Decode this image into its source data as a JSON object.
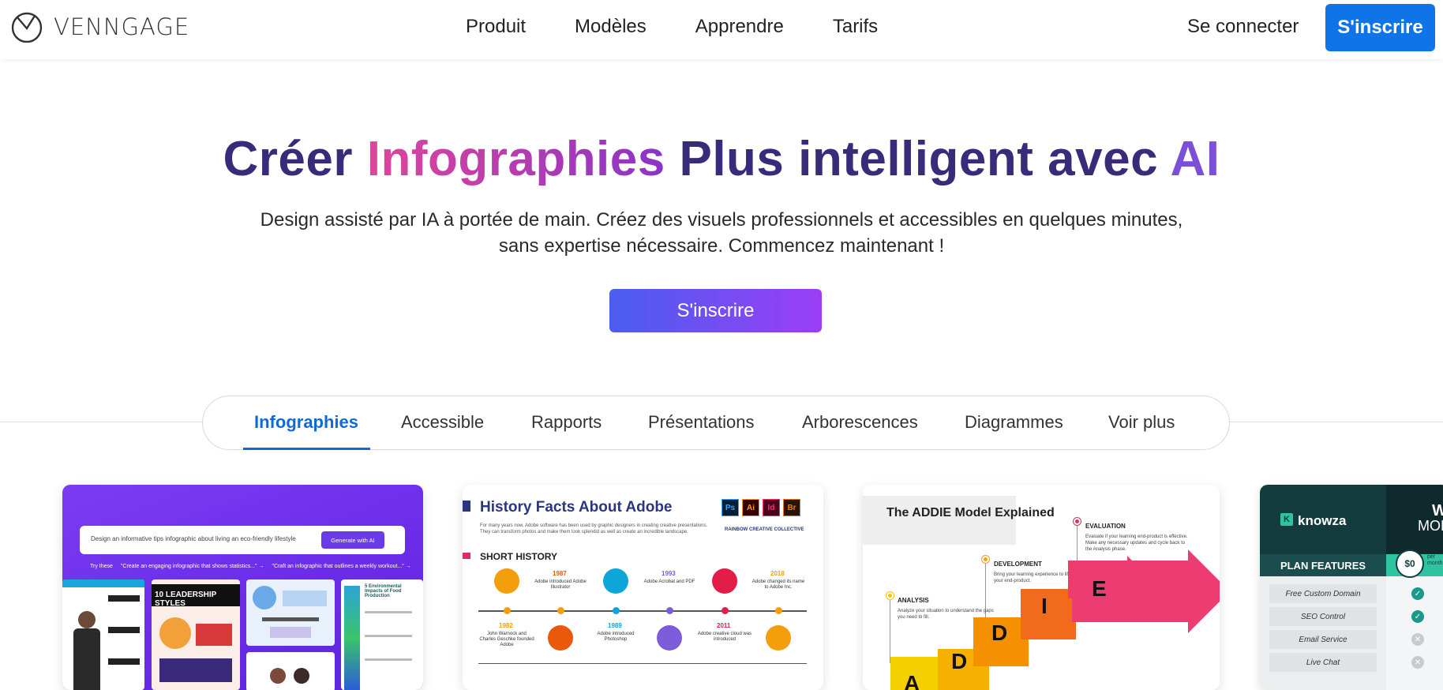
{
  "brand": {
    "name": "VENNGAGE"
  },
  "nav": {
    "links": [
      "Produit",
      "Modèles",
      "Apprendre",
      "Tarifs"
    ],
    "signin": "Se connecter",
    "signup": "S'inscrire"
  },
  "hero": {
    "title_part1": "Créer ",
    "title_part2": "Infographies",
    "title_part3": " Plus intelligent avec ",
    "title_part4": "AI",
    "subtitle": "Design assisté par IA à portée de main. Créez des visuels professionnels et accessibles en quelques minutes, sans expertise nécessaire. Commencez maintenant !",
    "cta": "S'inscrire"
  },
  "tabs": [
    "Infographies",
    "Accessible",
    "Rapports",
    "Présentations",
    "Arborescences",
    "Diagrammes",
    "Voir plus"
  ],
  "active_tab": "Infographies",
  "colors": {
    "accent": "#0f74e8",
    "title": "#3a2a7a",
    "gradient_start": "#4a5ef0",
    "gradient_end": "#9b3ef5"
  },
  "card1": {
    "prompt": "Design an informative tips infographic about living an eco-friendly lifestyle",
    "generate": "Generate with AI",
    "try_label": "Try these",
    "try1": "\"Create an engaging infographic that shows statistics...\" →",
    "try2": "\"Craft an infographic that outlines a weekly workout...\" →",
    "mini1_title": "10 LEADERSHIP STYLES",
    "mini2_title": "5 Environmental Impacts of Food Production"
  },
  "card2": {
    "title": "History Facts About Adobe",
    "desc": "For many years now, Adobe software has been used by graphic designers in creating creative presentations. They can transform photos and make them look splendid as well as create an incredible landscape.",
    "icons": [
      "Ps",
      "Ai",
      "Id",
      "Br"
    ],
    "collective": "RAINBOW CREATIVE COLLECTIVE",
    "section": "SHORT HISTORY",
    "timeline_top": [
      {
        "year": "1987",
        "text": "Adobe introduced Adobe Illustrator"
      },
      {
        "year": "1993",
        "text": "Adobe Acrobat and PDF"
      },
      {
        "year": "2018",
        "text": "Adobe changed its name to Adobe Inc."
      }
    ],
    "timeline_bottom": [
      {
        "year": "1982",
        "text": "John Warnock and Charles Geschke founded Adobe"
      },
      {
        "year": "1989",
        "text": "Adobe introduced Photoshop"
      },
      {
        "year": "2011",
        "text": "Adobe creative cloud was introduced"
      }
    ]
  },
  "card3": {
    "title": "The ADDIE Model Explained",
    "evaluation": "EVALUATION",
    "evaluation_text": "Evaluate if your learning end-product is effective. Make any necessary updates and cycle back to the Analysis phase.",
    "development": "DEVELOPMENT",
    "development_text": "Bring your learning experience to life by building your end-product.",
    "analysis": "ANALYSIS",
    "analysis_text": "Analyze your situation to understand the gaps you need to fill.",
    "letters": [
      "A",
      "D",
      "D",
      "I",
      "E"
    ]
  },
  "card4": {
    "logo": "knowza",
    "plan_features": "PLAN FEATURES",
    "price": "$0",
    "per": "per month",
    "month_label": "MONT",
    "w_label": "W",
    "features": [
      {
        "name": "Free Custom Domain",
        "included": "✓"
      },
      {
        "name": "SEO Control",
        "included": "✓"
      },
      {
        "name": "Email Service",
        "included": "✕"
      },
      {
        "name": "Live Chat",
        "included": "✕"
      }
    ]
  }
}
